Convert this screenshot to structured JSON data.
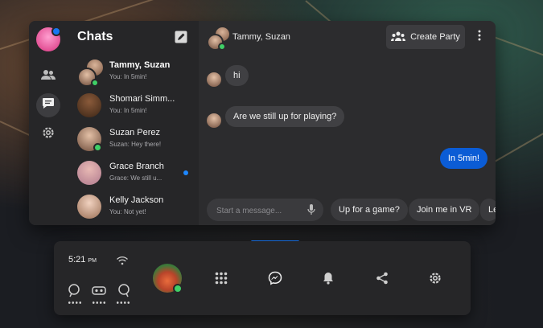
{
  "chats_panel": {
    "title": "Chats",
    "conversations": [
      {
        "name": "Tammy, Suzan",
        "preview": "You: In 5min!",
        "group": true,
        "online": true,
        "unread": false
      },
      {
        "name": "Shomari Simm...",
        "preview": "You: In 5min!",
        "group": false,
        "online": false,
        "unread": false
      },
      {
        "name": "Suzan Perez",
        "preview": "Suzan: Hey there!",
        "group": false,
        "online": true,
        "unread": false
      },
      {
        "name": "Grace Branch",
        "preview": "Grace: We still u...",
        "group": false,
        "online": false,
        "unread": true
      },
      {
        "name": "Kelly Jackson",
        "preview": "You: Not yet!",
        "group": false,
        "online": false,
        "unread": false
      }
    ]
  },
  "conversation": {
    "title": "Tammy, Suzan",
    "create_party_label": "Create Party",
    "messages": [
      {
        "direction": "in",
        "text": "hi"
      },
      {
        "direction": "in",
        "text": "Are we still up for playing?"
      },
      {
        "direction": "out",
        "text": "In 5min!"
      }
    ],
    "input_placeholder": "Start a message...",
    "quick_replies": [
      "Up for a game?",
      "Join me in VR",
      "Le"
    ]
  },
  "dock": {
    "time": "5:21",
    "ampm": "PM",
    "status_icons": [
      "controller-left-icon",
      "headset-icon",
      "controller-right-icon"
    ],
    "apps": [
      "apps-grid-icon",
      "messenger-icon",
      "bell-icon",
      "share-icon",
      "settings-icon"
    ]
  },
  "colors": {
    "accent": "#1877f2",
    "outgoing_bubble": "#0b5cd5",
    "online": "#3fd067",
    "panel": "#2a2a2c"
  }
}
